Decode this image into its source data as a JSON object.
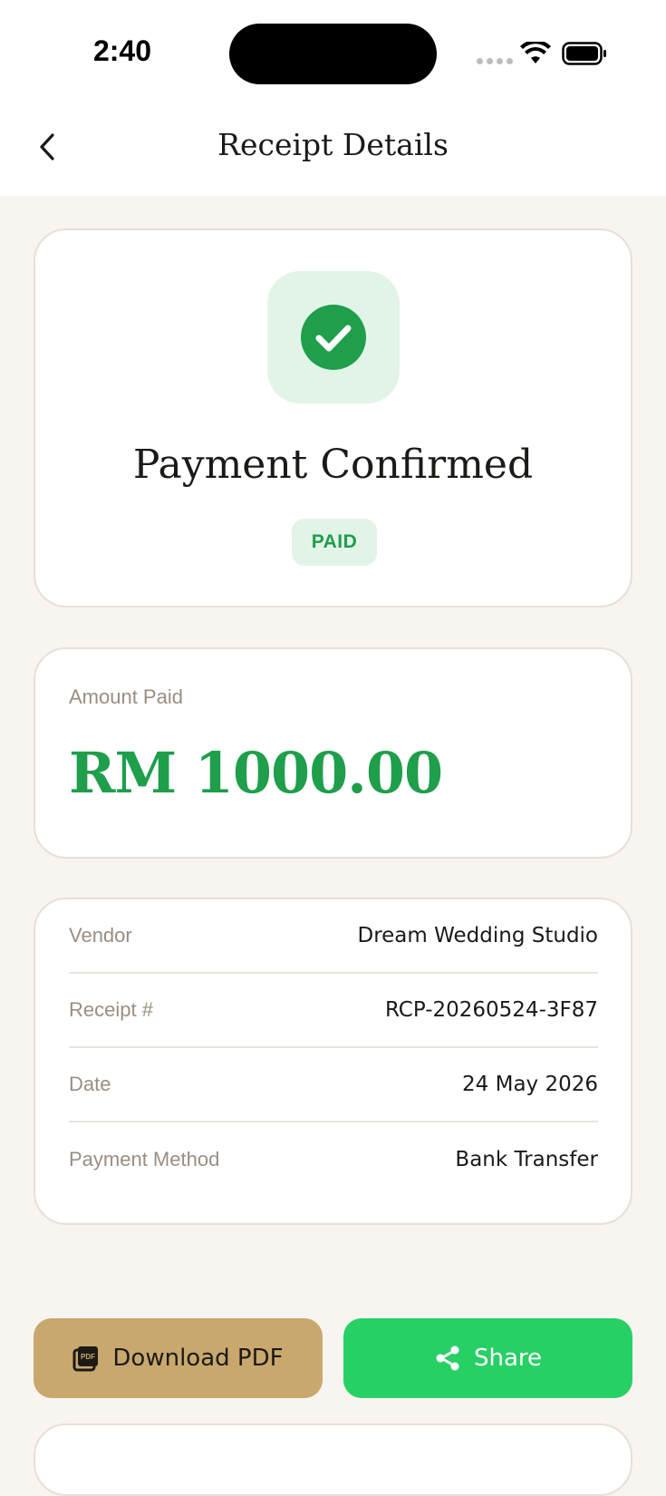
{
  "status_bar": {
    "time": "2:40"
  },
  "header": {
    "title": "Receipt Details"
  },
  "status_card": {
    "title": "Payment Confirmed",
    "badge": "PAID"
  },
  "amount_card": {
    "label": "Amount Paid",
    "value": "RM 1000.00"
  },
  "details": [
    {
      "label": "Vendor",
      "value": "Dream Wedding Studio"
    },
    {
      "label": "Receipt #",
      "value": "RCP-20260524-3F87"
    },
    {
      "label": "Date",
      "value": "24 May 2026"
    },
    {
      "label": "Payment Method",
      "value": "Bank Transfer"
    }
  ],
  "actions": {
    "download_label": "Download PDF",
    "share_label": "Share"
  },
  "colors": {
    "accent_green": "#1F9E4B",
    "gold": "#C9A86E",
    "share_green": "#27D065",
    "background": "#F8F5F1"
  },
  "icons": [
    "back-chevron-icon",
    "check-circle-icon",
    "pdf-icon",
    "share-icon",
    "wifi-icon",
    "battery-icon",
    "signal-icon"
  ]
}
